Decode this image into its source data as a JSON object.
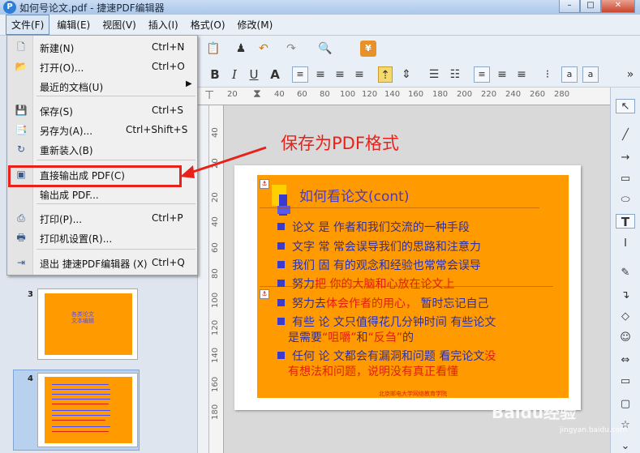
{
  "window": {
    "title": "如何号论文.pdf - 捷速PDF编辑器",
    "controls": [
      "–",
      "□",
      "✕"
    ]
  },
  "menubar": [
    "文件(F)",
    "编辑(E)",
    "视图(V)",
    "插入(I)",
    "格式(O)",
    "修改(M)"
  ],
  "file_menu": {
    "items": [
      {
        "label": "新建(N)",
        "shortcut": "Ctrl+N",
        "icon": "new-file-icon"
      },
      {
        "label": "打开(O)...",
        "shortcut": "Ctrl+O",
        "icon": "open-folder-icon"
      },
      {
        "label": "最近的文档(U)",
        "shortcut": "",
        "icon": "",
        "submenu": "▶"
      },
      {
        "label": "保存(S)",
        "shortcut": "Ctrl+S",
        "icon": "save-icon"
      },
      {
        "label": "另存为(A)...",
        "shortcut": "Ctrl+Shift+S",
        "icon": "save-as-icon"
      },
      {
        "label": "重新装入(B)",
        "shortcut": "",
        "icon": "reload-icon"
      },
      {
        "label": "直接输出成 PDF(C)",
        "shortcut": "",
        "icon": "pdf-export-icon"
      },
      {
        "label": "输出成 PDF...",
        "shortcut": "",
        "icon": ""
      },
      {
        "label": "打印(P)...",
        "shortcut": "Ctrl+P",
        "icon": "print-icon"
      },
      {
        "label": "打印机设置(R)...",
        "shortcut": "",
        "icon": "printer-settings-icon"
      },
      {
        "label": "退出 捷速PDF编辑器 (X)",
        "shortcut": "Ctrl+Q",
        "icon": "exit-icon"
      }
    ]
  },
  "annotation": "保存为PDF格式",
  "toolbar2": {
    "bold": "B",
    "italic": "I",
    "underline": "U",
    "shadow": "A"
  },
  "ruler": [
    "20",
    "40",
    "60",
    "80",
    "100",
    "120",
    "140",
    "160",
    "180",
    "200",
    "220",
    "240",
    "260",
    "280"
  ],
  "vruler": [
    "40",
    "20",
    "0",
    "20",
    "40",
    "60",
    "80",
    "100",
    "120",
    "140",
    "160",
    "180"
  ],
  "thumbnails": {
    "page3_number": "3",
    "page4_number": "4",
    "page3_title": "各类论文\n文本编辑"
  },
  "slide": {
    "title_main": "如何看论文",
    "title_cont": "(cont)",
    "bullets": [
      {
        "parts": [
          {
            "t": "论文 是 作者和我们交流的一种手段",
            "c": "blue"
          }
        ]
      },
      {
        "parts": [
          {
            "t": "文字 常 常会误导我们的思路和注意力",
            "c": "blue"
          }
        ]
      },
      {
        "parts": [
          {
            "t": "我们 固 有的观念和经验也常常会误导",
            "c": "blue"
          }
        ]
      },
      {
        "parts": [
          {
            "t": "努力",
            "c": "blue"
          },
          {
            "t": "把 你的大脑和心放在论文上",
            "c": "red"
          }
        ]
      },
      {
        "parts": [
          {
            "t": "努力去",
            "c": "blue"
          },
          {
            "t": "体会作者的用心，",
            "c": "red"
          },
          {
            "t": " 暂时忘记自己",
            "c": "blue"
          }
        ]
      },
      {
        "parts": [
          {
            "t": "有些 论 文只值得花几分钟时间 有些论文",
            "c": "blue"
          }
        ]
      },
      {
        "parts": [
          {
            "t": "任何 论 文都会有漏洞和问题 看完论文",
            "c": "blue"
          },
          {
            "t": "没",
            "c": "red"
          }
        ]
      }
    ],
    "bullet6_line2": [
      {
        "t": "是需要",
        "c": "blue"
      },
      {
        "t": "“咀嚼”",
        "c": "red"
      },
      {
        "t": "和",
        "c": "blue"
      },
      {
        "t": "“反刍”",
        "c": "red"
      },
      {
        "t": "的",
        "c": "blue"
      }
    ],
    "bullet7_line2": "有想法和问题，说明没有真正看懂",
    "footer": "北京邮电大学网络教育学院"
  },
  "watermark": {
    "main": "Baidu经验",
    "sub": "jingyan.baidu.com"
  },
  "colors": {
    "slide_bg": "#ff9a00",
    "text_blue": "#2d2fa6",
    "text_red": "#e01f0c",
    "highlight": "#e8221a"
  }
}
